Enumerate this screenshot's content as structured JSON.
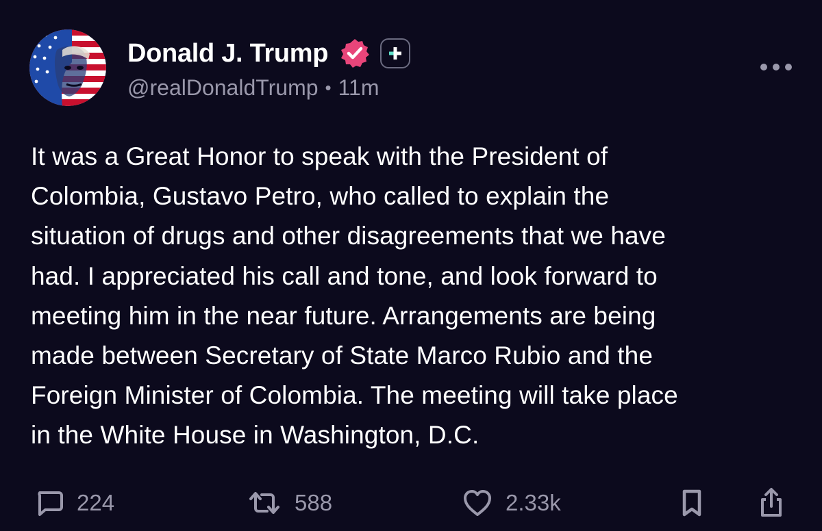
{
  "post": {
    "author": {
      "display_name": "Donald J. Trump",
      "handle": "@realDonaldTrump",
      "time_separator": "•",
      "time_ago": "11m",
      "verified": true,
      "avatar_icon": "flag-portrait-avatar",
      "badges": [
        "verified-badge-icon",
        "plus-badge-icon"
      ]
    },
    "text_lines": [
      "It was a Great Honor to speak with the President of",
      "Colombia, Gustavo Petro, who called to explain the",
      "situation of drugs and other disagreements that we have",
      "had. I appreciated his call and tone, and look forward to",
      "meeting him in the near future. Arrangements are being",
      "made between Secretary of State Marco Rubio and the",
      "Foreign Minister of Colombia. The meeting will take place",
      "in the White House in Washington, D.C."
    ],
    "actions": {
      "replies": "224",
      "reposts": "588",
      "likes": "2.33k"
    },
    "icons": {
      "reply": "reply-bubble-icon",
      "repost": "repost-arrows-icon",
      "like": "heart-icon",
      "bookmark": "bookmark-icon",
      "share": "share-icon",
      "more": "more-dots-icon"
    }
  },
  "colors": {
    "background": "#0c0a1d",
    "text": "#ffffff",
    "muted": "#9a98ab",
    "verified": "#e8457a",
    "plus_accent": "#5fe0c9"
  }
}
